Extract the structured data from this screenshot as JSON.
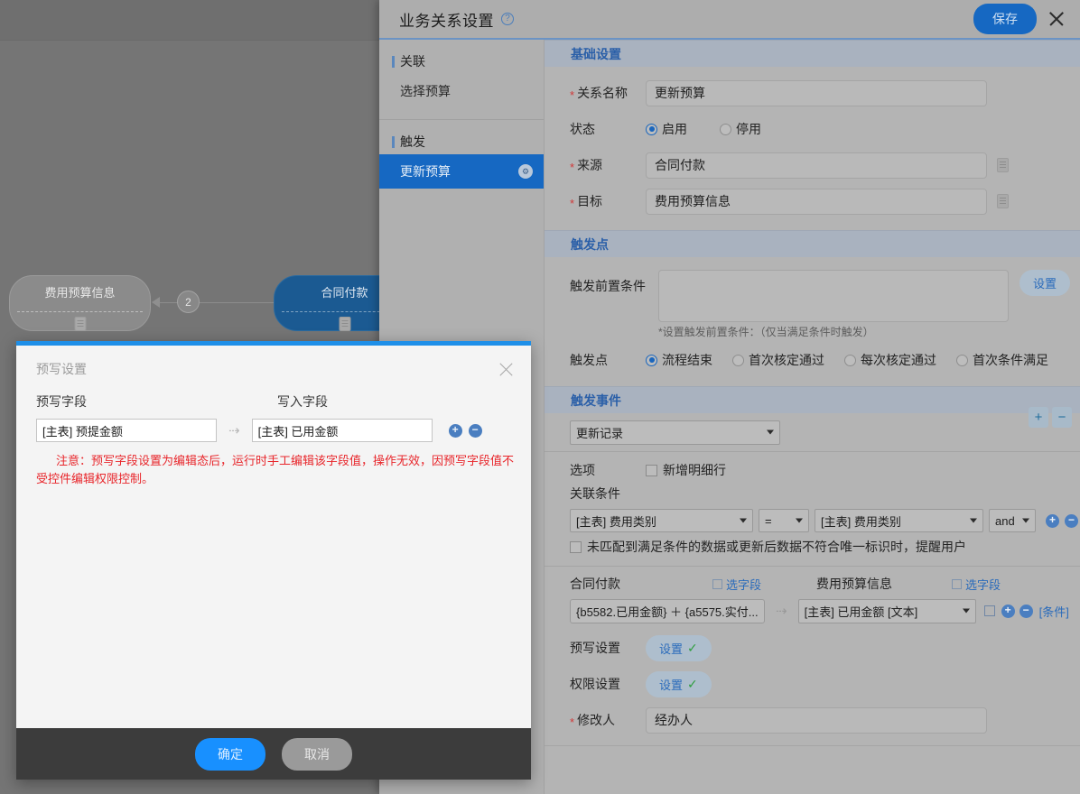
{
  "background": {
    "nodes": [
      {
        "label": "费用预算信息",
        "icon": "document-icon"
      },
      {
        "label": "合同付款",
        "icon": "document-icon"
      }
    ],
    "edge_badge": "2"
  },
  "panel": {
    "title": "业务关系设置",
    "help_icon": "?",
    "save_label": "保存",
    "accent_color": "#1668c2"
  },
  "sidebar": {
    "groups": [
      {
        "label": "关联",
        "items": [
          {
            "label": "选择预算",
            "selected": false
          }
        ]
      },
      {
        "label": "触发",
        "items": [
          {
            "label": "更新预算",
            "selected": true,
            "badge_icon": "settings-icon"
          }
        ]
      }
    ]
  },
  "basic": {
    "section_title": "基础设置",
    "name_label": "关系名称",
    "name_value": "更新预算",
    "status_label": "状态",
    "status_options": [
      {
        "label": "启用",
        "selected": true
      },
      {
        "label": "停用",
        "selected": false
      }
    ],
    "source_label": "来源",
    "source_value": "合同付款",
    "target_label": "目标",
    "target_value": "费用预算信息"
  },
  "trigger_point": {
    "section_title": "触发点",
    "precondition_label": "触发前置条件",
    "precondition_value": "",
    "setting_button": "设置",
    "hint": "*设置触发前置条件：（仅当满足条件时触发）",
    "point_label": "触发点",
    "point_options": [
      {
        "label": "流程结束",
        "selected": true
      },
      {
        "label": "首次核定通过",
        "selected": false
      },
      {
        "label": "每次核定通过",
        "selected": false
      },
      {
        "label": "首次条件满足",
        "selected": false
      }
    ]
  },
  "trigger_event": {
    "section_title": "触发事件",
    "add_label": "+",
    "remove_label": "−",
    "event_type": "更新记录",
    "options_label": "选项",
    "option_checkbox": {
      "label": "新增明细行",
      "checked": false
    },
    "relation_label": "关联条件",
    "condition_row": {
      "left_field": "[主表] 费用类别",
      "operator": "=",
      "right_field": "[主表] 费用类别",
      "logic": "and",
      "add_icon": "plus-circle-icon",
      "remove_icon": "minus-circle-icon"
    },
    "warn_checkbox": {
      "label": "未匹配到满足条件的数据或更新后数据不符合唯一标识时，提醒用户",
      "checked": false
    },
    "mapping": {
      "left_title": "合同付款",
      "left_pick_field": "选字段",
      "right_title": "费用预算信息",
      "right_pick_field": "选字段",
      "expression": "{b5582.已用金额} ＋ {a5575.实付...",
      "target_field": "[主表] 已用金额 [文本]",
      "copy_icon": "copy-icon",
      "add_icon": "plus-circle-icon",
      "remove_icon": "minus-circle-icon",
      "condition_link": "[条件]"
    },
    "prewrite_label": "预写设置",
    "prewrite_button": "设置",
    "permission_label": "权限设置",
    "permission_button": "设置",
    "modifier_label": "修改人",
    "modifier_value": "经办人"
  },
  "modal": {
    "title": "预写设置",
    "close_icon": "close-icon",
    "col_left": "预写字段",
    "col_right": "写入字段",
    "left_value": "[主表] 预提金额",
    "right_value": "[主表] 已用金额",
    "arrow": "⇢",
    "add_icon": "plus-circle-icon",
    "remove_icon": "minus-circle-icon",
    "warning": "注意：预写字段设置为编辑态后，运行时手工编辑该字段值，操作无效，因预写字段值不受控件编辑权限控制。",
    "ok_label": "确定",
    "cancel_label": "取消"
  }
}
